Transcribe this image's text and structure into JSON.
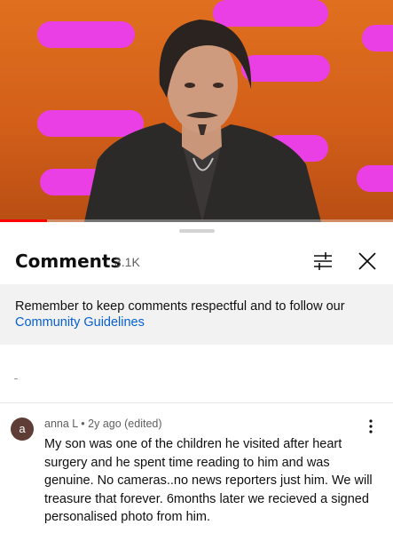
{
  "video": {
    "progress_fraction": 0.12,
    "colors": {
      "backdrop": "#d7651b",
      "bars": "#ea3fe4",
      "progress": "#ff0000"
    }
  },
  "panel": {
    "title": "Comments",
    "count": "3.1K",
    "filter_icon": "sliders-icon",
    "close_icon": "close-icon"
  },
  "notice": {
    "text": "Remember to keep comments respectful and to follow our ",
    "link": "Community Guidelines"
  },
  "comments": [
    {
      "avatar_letter": "a",
      "author": "anna L",
      "separator": "•",
      "time": "2y ago (edited)",
      "text": "My son was one of the children he visited after heart surgery and he spent time reading to him and was genuine. No cameras..no news reporters just him. We will treasure that forever. 6months later we recieved a signed personalised photo from him."
    }
  ],
  "colors": {
    "link": "#065fd4",
    "notice_bg": "#f2f2f2",
    "secondary_text": "#606060"
  }
}
